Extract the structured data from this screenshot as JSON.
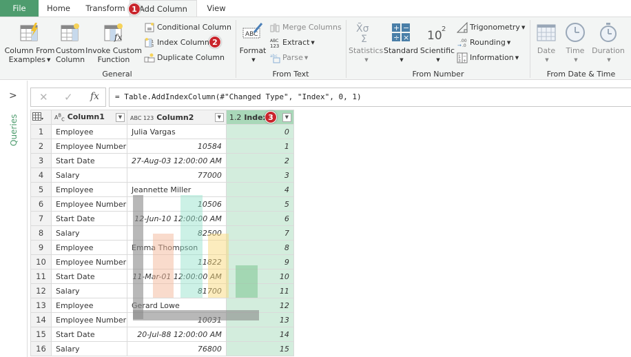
{
  "tabs": [
    {
      "label": "File",
      "active": false
    },
    {
      "label": "Home",
      "active": false
    },
    {
      "label": "Transform",
      "active": false
    },
    {
      "label": "Add Column",
      "active": true
    },
    {
      "label": "View",
      "active": false
    }
  ],
  "badges": [
    "1",
    "2",
    "3"
  ],
  "ribbon": {
    "general": {
      "label": "General",
      "column_from_examples": [
        "Column From",
        "Examples"
      ],
      "custom_column": [
        "Custom",
        "Column"
      ],
      "invoke_custom_function": [
        "Invoke Custom",
        "Function"
      ],
      "conditional_column": "Conditional Column",
      "index_column": "Index Column",
      "duplicate_column": "Duplicate Column"
    },
    "from_text": {
      "label": "From Text",
      "format": "Format",
      "merge_columns": "Merge Columns",
      "extract": "Extract",
      "parse": "Parse"
    },
    "from_number": {
      "label": "From Number",
      "statistics": "Statistics",
      "standard": "Standard",
      "scientific": "Scientific",
      "trigonometry": "Trigonometry",
      "rounding": "Rounding",
      "information": "Information"
    },
    "from_datetime": {
      "label": "From Date & Time",
      "date": "Date",
      "time": "Time",
      "duration": "Duration"
    }
  },
  "queries_panel": {
    "label": "Queries"
  },
  "formula_bar": {
    "formula": "= Table.AddIndexColumn(#\"Changed Type\", \"Index\", 0, 1)"
  },
  "table": {
    "columns": [
      {
        "type": "ABC",
        "name": "Column1"
      },
      {
        "type": "ABC 123",
        "name": "Column2"
      },
      {
        "type": "1.2",
        "name": "Index"
      }
    ],
    "rows": [
      {
        "n": "1",
        "c1": "Employee",
        "c2": "Julia Vargas",
        "c2num": false,
        "idx": "0"
      },
      {
        "n": "2",
        "c1": "Employee Number",
        "c2": "10584",
        "c2num": true,
        "idx": "1"
      },
      {
        "n": "3",
        "c1": "Start Date",
        "c2": "27-Aug-03 12:00:00 AM",
        "c2num": true,
        "idx": "2"
      },
      {
        "n": "4",
        "c1": "Salary",
        "c2": "77000",
        "c2num": true,
        "idx": "3"
      },
      {
        "n": "5",
        "c1": "Employee",
        "c2": "Jeannette Miller",
        "c2num": false,
        "idx": "4"
      },
      {
        "n": "6",
        "c1": "Employee Number",
        "c2": "10506",
        "c2num": true,
        "idx": "5"
      },
      {
        "n": "7",
        "c1": "Start Date",
        "c2": "12-Jun-10 12:00:00 AM",
        "c2num": true,
        "idx": "6"
      },
      {
        "n": "8",
        "c1": "Salary",
        "c2": "82500",
        "c2num": true,
        "idx": "7"
      },
      {
        "n": "9",
        "c1": "Employee",
        "c2": "Emma Thompson",
        "c2num": false,
        "idx": "8"
      },
      {
        "n": "10",
        "c1": "Employee Number",
        "c2": "11822",
        "c2num": true,
        "idx": "9"
      },
      {
        "n": "11",
        "c1": "Start Date",
        "c2": "11-Mar-01 12:00:00 AM",
        "c2num": true,
        "idx": "10"
      },
      {
        "n": "12",
        "c1": "Salary",
        "c2": "81700",
        "c2num": true,
        "idx": "11"
      },
      {
        "n": "13",
        "c1": "Employee",
        "c2": "Gerard Lowe",
        "c2num": false,
        "idx": "12"
      },
      {
        "n": "14",
        "c1": "Employee Number",
        "c2": "10031",
        "c2num": true,
        "idx": "13"
      },
      {
        "n": "15",
        "c1": "Start Date",
        "c2": "20-Jul-88 12:00:00 AM",
        "c2num": true,
        "idx": "14"
      },
      {
        "n": "16",
        "c1": "Salary",
        "c2": "76800",
        "c2num": true,
        "idx": "15"
      }
    ]
  },
  "colors": {
    "accent": "#4e9c6e",
    "badge": "#c9252c",
    "index_column_fill": "#d3eddd",
    "index_header_fill": "#a9d8b9"
  }
}
